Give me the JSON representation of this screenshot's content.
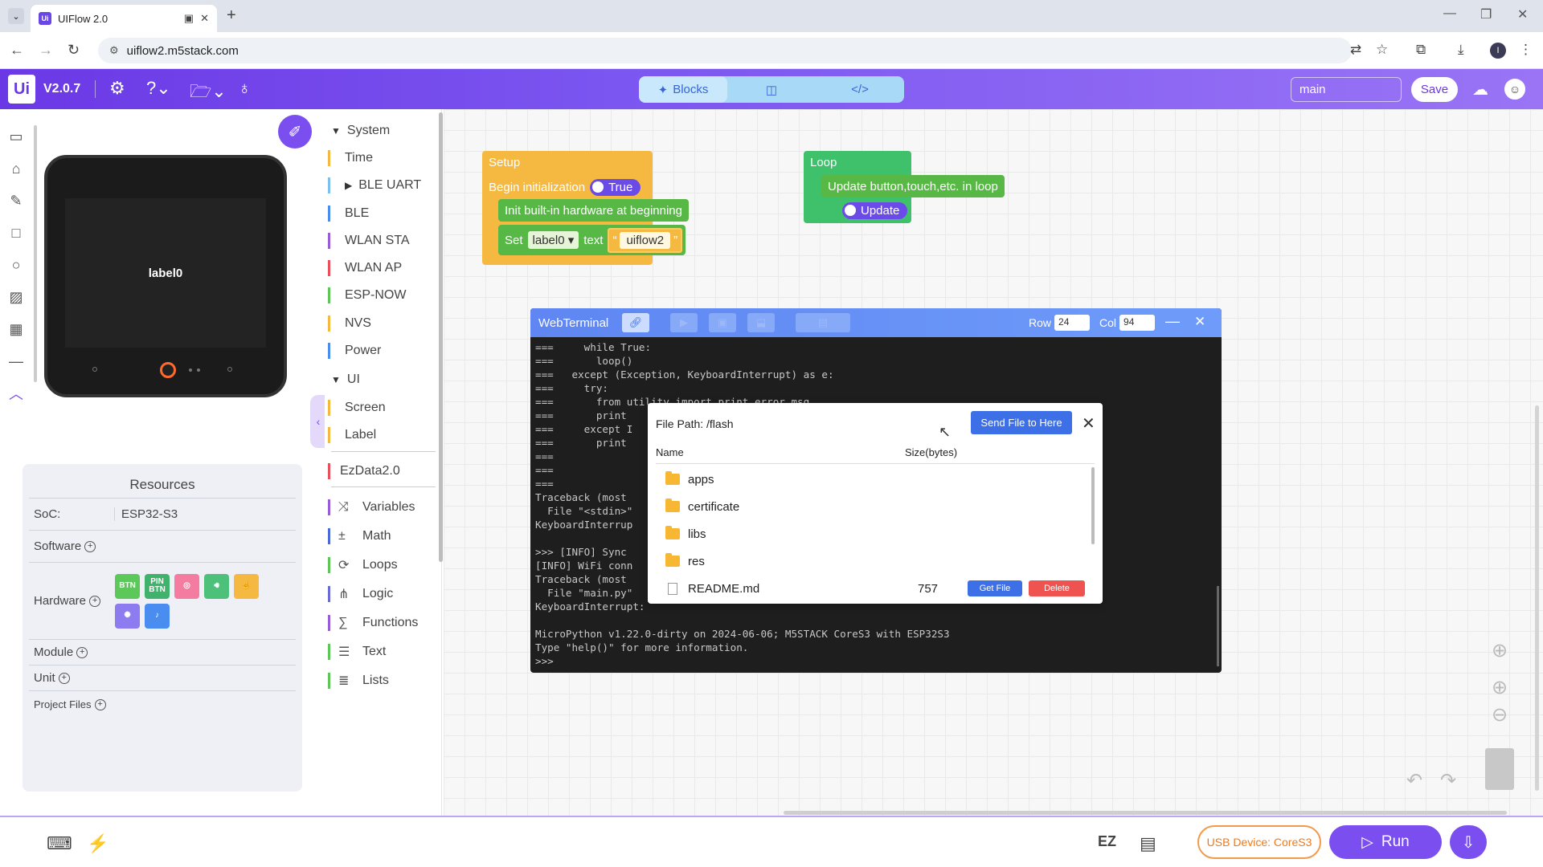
{
  "browser": {
    "tab_title": "UIFlow 2.0",
    "url": "uiflow2.m5stack.com",
    "profile_initial": "I"
  },
  "header": {
    "logo_text": "Ui",
    "version": "V2.0.7",
    "mode_tabs": [
      {
        "label": "Blocks",
        "icon": "puzzle-icon"
      },
      {
        "label": "",
        "icon": "split-view-icon"
      },
      {
        "label": "",
        "icon": "code-icon"
      }
    ],
    "branch": "main",
    "save_label": "Save"
  },
  "device": {
    "screen_label": "label0"
  },
  "resources": {
    "title": "Resources",
    "soc_label": "SoC:",
    "soc_value": "ESP32-S3",
    "software_label": "Software",
    "hardware_label": "Hardware",
    "module_label": "Module",
    "unit_label": "Unit",
    "project_files_label": "Project Files",
    "hardware_items": [
      {
        "label": "BTN",
        "color": "#5cc85a"
      },
      {
        "label": "PIN BTN",
        "color": "#3fb36c"
      },
      {
        "label": "",
        "color": "#f47ca0",
        "icon": "ring-icon"
      },
      {
        "label": "",
        "color": "#4dc07a",
        "icon": "speaker-icon"
      },
      {
        "label": "",
        "color": "#f5b942",
        "icon": "touch-icon"
      },
      {
        "label": "",
        "color": "#8c7cf0",
        "icon": "light-icon"
      },
      {
        "label": "",
        "color": "#4a8df0",
        "icon": "mic-icon"
      }
    ]
  },
  "categories": {
    "system": "System",
    "time": "Time",
    "ble_uart": "BLE UART",
    "ble": "BLE",
    "wlan_sta": "WLAN STA",
    "wlan_ap": "WLAN AP",
    "esp_now": "ESP-NOW",
    "nvs": "NVS",
    "power": "Power",
    "ui": "UI",
    "screen": "Screen",
    "label": "Label",
    "ezdata": "EzData2.0",
    "variables": "Variables",
    "math": "Math",
    "loops": "Loops",
    "logic": "Logic",
    "functions": "Functions",
    "text": "Text",
    "lists": "Lists"
  },
  "blocks": {
    "setup_title": "Setup",
    "begin_init": "Begin initialization",
    "true_label": "True",
    "init_hw": "Init built-in hardware at beginning",
    "set_label": "Set",
    "label_dropdown": "label0",
    "text_label": "text",
    "string_value": "uiflow2",
    "loop_title": "Loop",
    "update_loop": "Update button,touch,etc. in loop",
    "update_label": "Update"
  },
  "terminal": {
    "title": "WebTerminal",
    "row_label": "Row",
    "row_value": "24",
    "col_label": "Col",
    "col_value": "94",
    "output": "===     while True:\n===       loop()\n===   except (Exception, KeyboardInterrupt) as e:\n===     try:\n===       from utility import print_error_msg\n===       print\n===     except I\n===       print\n===\n===\n===\nTraceback (most\n  File \"<stdin>\"\nKeyboardInterrup\n\n>>> [INFO] Sync\n[INFO] WiFi conn\nTraceback (most\n  File \"main.py\"\nKeyboardInterrupt:\n\nMicroPython v1.22.0-dirty on 2024-06-06; M5STACK CoreS3 with ESP32S3\nType \"help()\" for more information.\n>>> "
  },
  "file_dialog": {
    "path_label": "File Path: /flash",
    "send_button": "Send File to Here",
    "col_name": "Name",
    "col_size": "Size(bytes)",
    "items": [
      {
        "name": "apps",
        "type": "folder",
        "size": ""
      },
      {
        "name": "certificate",
        "type": "folder",
        "size": ""
      },
      {
        "name": "libs",
        "type": "folder",
        "size": ""
      },
      {
        "name": "res",
        "type": "folder",
        "size": ""
      },
      {
        "name": "README.md",
        "type": "file",
        "size": "757"
      }
    ],
    "get_file_label": "Get File",
    "delete_label": "Delete"
  },
  "bottombar": {
    "usb_device": "USB Device: CoreS3",
    "run_label": "Run",
    "ez_label": "EZ"
  }
}
